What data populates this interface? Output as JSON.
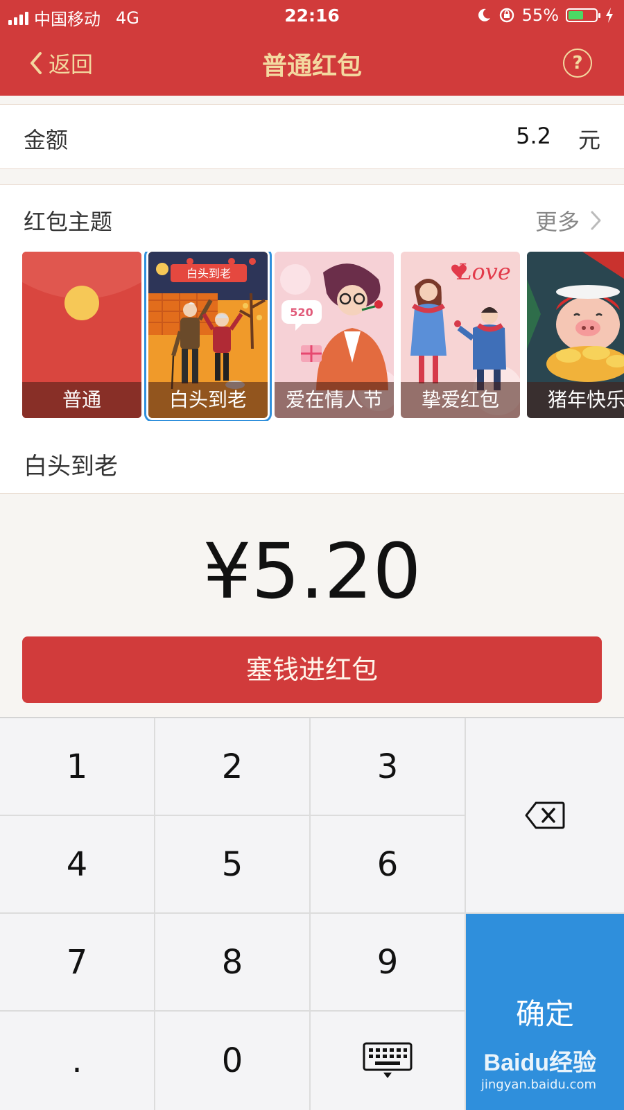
{
  "status_bar": {
    "carrier": "中国移动",
    "network": "4G",
    "time": "22:16",
    "battery": "55%",
    "battery_level": 0.55
  },
  "nav": {
    "back_label": "返回",
    "title": "普通红包",
    "help_icon": "question-circle-icon"
  },
  "amount": {
    "label": "金额",
    "value": "5.2",
    "unit": "元"
  },
  "theme": {
    "label": "红包主题",
    "more": "更多",
    "cards": [
      {
        "label": "普通",
        "selected": false
      },
      {
        "label": "白头到老",
        "selected": true
      },
      {
        "label": "爱在情人节",
        "selected": false
      },
      {
        "label": "挚爱红包",
        "selected": false
      },
      {
        "label": "猪年快乐",
        "selected": false
      }
    ],
    "card_texts": {
      "card2_banner": "白头到老",
      "card3_badge": "520",
      "card4_love": "Love"
    }
  },
  "selected_theme": "白头到老",
  "display_amount": "¥5.20",
  "submit_label": "塞钱进红包",
  "keypad": {
    "keys": [
      "1",
      "2",
      "3",
      "4",
      "5",
      "6",
      "7",
      "8",
      "9",
      ".",
      "0"
    ],
    "delete_icon": "backspace-icon",
    "keyboard_icon": "keyboard-hide-icon",
    "confirm_label": "确定"
  },
  "watermark": {
    "logo": "Baidu经验",
    "url": "jingyan.baidu.com"
  },
  "colors": {
    "brand_red": "#d13b3b",
    "accent_gold": "#f3d9a0",
    "confirm_blue": "#2f8fdc"
  }
}
